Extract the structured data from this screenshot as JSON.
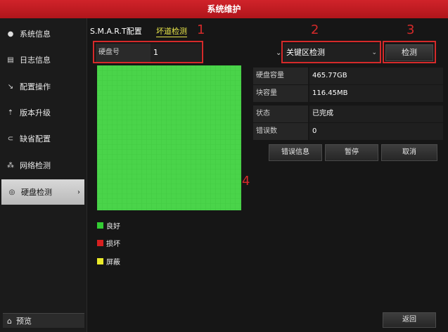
{
  "window": {
    "title": "系统维护"
  },
  "sidebar": {
    "items": [
      {
        "label": "系统信息",
        "icon": "info-icon"
      },
      {
        "label": "日志信息",
        "icon": "log-icon"
      },
      {
        "label": "配置操作",
        "icon": "config-icon"
      },
      {
        "label": "版本升级",
        "icon": "upgrade-icon"
      },
      {
        "label": "缺省配置",
        "icon": "default-icon"
      },
      {
        "label": "网络检测",
        "icon": "network-icon"
      },
      {
        "label": "硬盘检测",
        "icon": "disk-icon",
        "active": true
      }
    ],
    "preview_label": "预览"
  },
  "tabs": [
    {
      "label": "S.M.A.R.T配置"
    },
    {
      "label": "坏道检测",
      "active": true
    }
  ],
  "disk": {
    "label": "硬盘号",
    "value": "1"
  },
  "mode": {
    "value": "关键区检测"
  },
  "detect_button": "检测",
  "info": [
    {
      "key": "硬盘容量",
      "value": "465.77GB"
    },
    {
      "key": "块容量",
      "value": "116.45MB"
    },
    {
      "key": "状态",
      "value": "已完成"
    },
    {
      "key": "错误数",
      "value": "0"
    }
  ],
  "actions": {
    "error_info": "错误信息",
    "pause": "暂停",
    "cancel": "取消"
  },
  "legend": [
    {
      "label": "良好",
      "color": "#33cc33"
    },
    {
      "label": "损坏",
      "color": "#d62020"
    },
    {
      "label": "屏蔽",
      "color": "#eaea2a"
    }
  ],
  "back_button": "返回",
  "annotations": [
    "1",
    "2",
    "3",
    "4"
  ],
  "colors": {
    "title_bar": "#c41a20",
    "annotation": "#d52a2a",
    "good_block": "#4ad44a"
  }
}
